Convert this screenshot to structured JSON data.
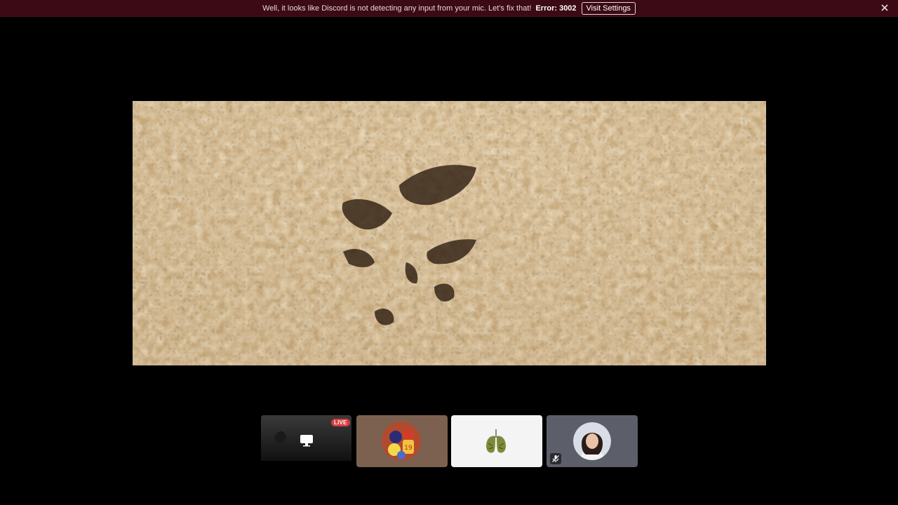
{
  "notice": {
    "message": "Well, it looks like Discord is not detecting any input from your mic. Let's fix that!",
    "error": "Error: 3002",
    "button": "Visit Settings"
  },
  "tiles": {
    "live_badge": "LIVE"
  },
  "colors": {
    "notice_bg": "#3b0a14",
    "live_badge": "#d83c3e",
    "tile_bg_2": "#7c6150",
    "tile_bg_4": "#5c5f6a"
  }
}
